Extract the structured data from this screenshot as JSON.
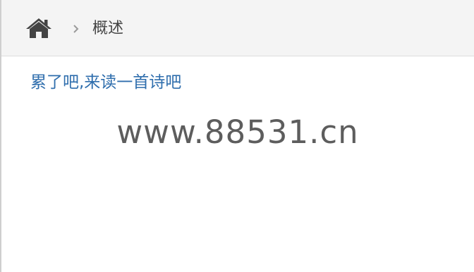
{
  "breadcrumb": {
    "home_icon": "home-icon",
    "separator_icon": "chevron-right-icon",
    "current": "概述"
  },
  "content": {
    "title_link": "累了吧,来读一首诗吧",
    "site_text": "www.88531.cn"
  },
  "colors": {
    "breadcrumb_bg": "#f4f4f4",
    "link": "#2f6ead",
    "text": "#5d5d5d",
    "icon": "#444444"
  }
}
